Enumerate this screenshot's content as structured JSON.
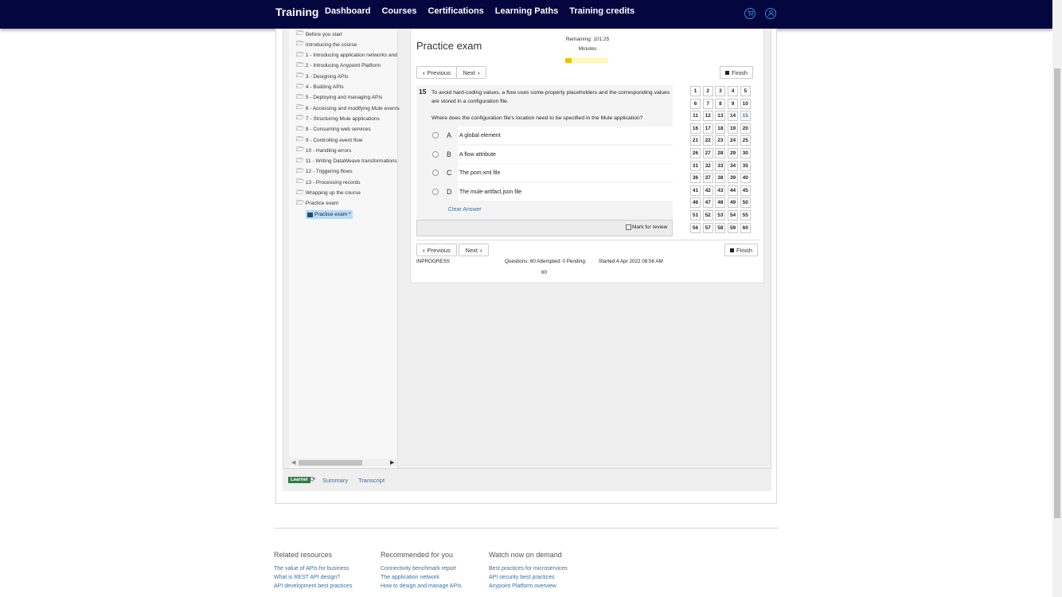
{
  "nav": {
    "brand": "Training",
    "links": [
      "Dashboard",
      "Courses",
      "Certifications",
      "Learning Paths",
      "Training credits"
    ],
    "icons": [
      "cart-icon",
      "user-icon"
    ]
  },
  "outline": {
    "items": [
      "Before you start",
      "Introducing the course",
      "1 - Introducing application networks and",
      "2 - Introducing Anypoint Platform",
      "3 - Designing APIs",
      "4 - Building APIs",
      "5 - Deploying and managing APIs",
      "6 - Accessing and modifying Mule events",
      "7 - Structuring Mule applications",
      "8 - Consuming web services",
      "9 - Controlling event flow",
      "10 - Handling errors",
      "11 - Writing DataWeave transformations",
      "12 - Triggering flows",
      "13 - Processing records",
      "Wrapping up the course",
      "Practice exam"
    ],
    "selected": "Practice exam *"
  },
  "bottom": {
    "badge": "Learner",
    "summary": "Summary",
    "transcript": "Transcript"
  },
  "exam": {
    "title": "Practice exam",
    "remaining": "Remaining: 101:25",
    "minutes": "Minutes",
    "progress_fraction": 0.15,
    "prev": "Previous",
    "next": "Next",
    "finish": "Finish",
    "question_number": "15",
    "question_text": "To avoid hard-coding values, a flow uses some property placeholders and the corresponding values are stored in a configuration file.",
    "question_sub": "Where does the configuration file's location need to be specified in the Mule application?",
    "options": [
      {
        "letter": "A",
        "text": "A global element"
      },
      {
        "letter": "B",
        "text": "A flow attribute"
      },
      {
        "letter": "C",
        "text": "The pom.xml file"
      },
      {
        "letter": "D",
        "text": "The mule-artifact.json file"
      }
    ],
    "clear_answer": "Clear Answer",
    "mark_review": "Mark for review",
    "current_question": 15,
    "question_count": 60,
    "status": "INPROGRESS",
    "stats_line1": "Questions: 60 Attempted: 0 Pending:",
    "stats_line2": "60",
    "started": "Started:4 Apr 2022 08:56 AM"
  },
  "footer": {
    "cols": [
      {
        "title": "Related resources",
        "links": [
          "The value of APIs for business",
          "What is REST API design?",
          "API development best practices"
        ]
      },
      {
        "title": "Recommended for you",
        "links": [
          "Connectivity benchmark report",
          "The application network",
          "How to design and manage APIs"
        ]
      },
      {
        "title": "Watch now on demand",
        "links": [
          "Best practices for microservices",
          "API security best practices",
          "Anypoint Platform overview"
        ]
      }
    ]
  }
}
